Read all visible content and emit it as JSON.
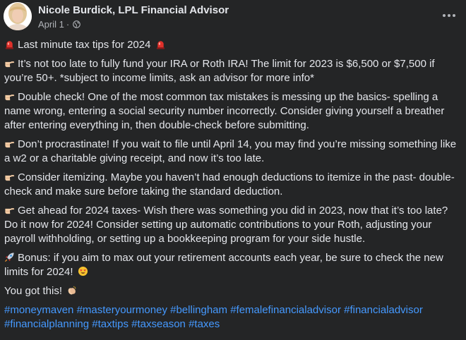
{
  "post": {
    "author": "Nicole Burdick, LPL Financial Advisor",
    "date": "April 1",
    "separator": "·",
    "title": "Last minute tax tips for 2024",
    "paragraphs": [
      "It’s not too late to fully fund your IRA or Roth IRA! The limit for 2023 is $6,500 or $7,500 if you’re 50+. *subject to income limits, ask an advisor for more info*",
      "Double check!  One of the most common tax mistakes is messing up the basics- spelling a name wrong, entering a social security number incorrectly. Consider giving yourself a breather after entering everything in, then double-check before submitting.",
      "Don’t procrastinate! If you wait to file until April 14,  you may find you’re missing something like a w2 or a charitable giving receipt, and now it’s too late.",
      "Consider itemizing. Maybe you haven’t had enough deductions to itemize in the past- double-check and make sure before taking the standard deduction.",
      "Get ahead for 2024 taxes- Wish there was something you did in 2023, now that it’s too late? Do it now for 2024! Consider setting up automatic contributions to your Roth, adjusting your payroll withholding, or setting up a bookkeeping program for your side hustle."
    ],
    "bonus": "Bonus: if you aim to max out your retirement accounts each year, be sure to check the new limits for 2024!",
    "closing": "You got this!",
    "hashtags": [
      "#moneymaven",
      "#masteryourmoney",
      "#bellingham",
      "#femalefinancialadvisor",
      "#financialadvisor",
      "#financialplanning",
      "#taxtips",
      "#taxseason",
      "#taxes"
    ]
  },
  "icons": {
    "title_emoji": "siren-emoji",
    "bullet_emoji": "pointing-hand-emoji",
    "bonus_emoji": "rocket-emoji",
    "bonus_end_emoji": "star-struck-emoji",
    "closing_emoji": "clapping-hands-emoji",
    "privacy": "globe-icon",
    "menu": "more-options-icon"
  },
  "colors": {
    "background": "#242526",
    "text": "#e4e6eb",
    "secondary_text": "#b0b3b8",
    "hashtag": "#4599ff"
  }
}
